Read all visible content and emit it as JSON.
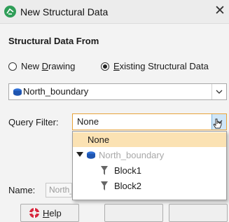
{
  "window": {
    "title": "New Structural Data",
    "close_glyph": "✕"
  },
  "section": {
    "title": "Structural Data From"
  },
  "source": {
    "options": [
      "New Drawing",
      "Existing Structural Data"
    ],
    "option_underlines": [
      "D",
      "E"
    ],
    "selected": "Existing Structural Data"
  },
  "structural_select": {
    "value": "North_boundary"
  },
  "query_filter": {
    "label": "Query Filter:",
    "value": "None"
  },
  "name": {
    "label": "Name:",
    "value": "North_boundary"
  },
  "help_button": {
    "label": "Help",
    "underline": "H"
  },
  "dropdown": {
    "items": [
      {
        "label": "None",
        "selected": true
      },
      {
        "label": "North_boundary",
        "disabled": true,
        "expanded": true
      },
      {
        "label": "Block1"
      },
      {
        "label": "Block2"
      }
    ]
  },
  "colors": {
    "accent": "#2f9e58",
    "selection": "#fbe2b3",
    "structural_icon": "#2e6fd6",
    "focus_border": "#e8a33a"
  },
  "icons": {
    "app": "structural-data-icon",
    "help": "lifebuoy-icon",
    "filter": "funnel-icon"
  }
}
